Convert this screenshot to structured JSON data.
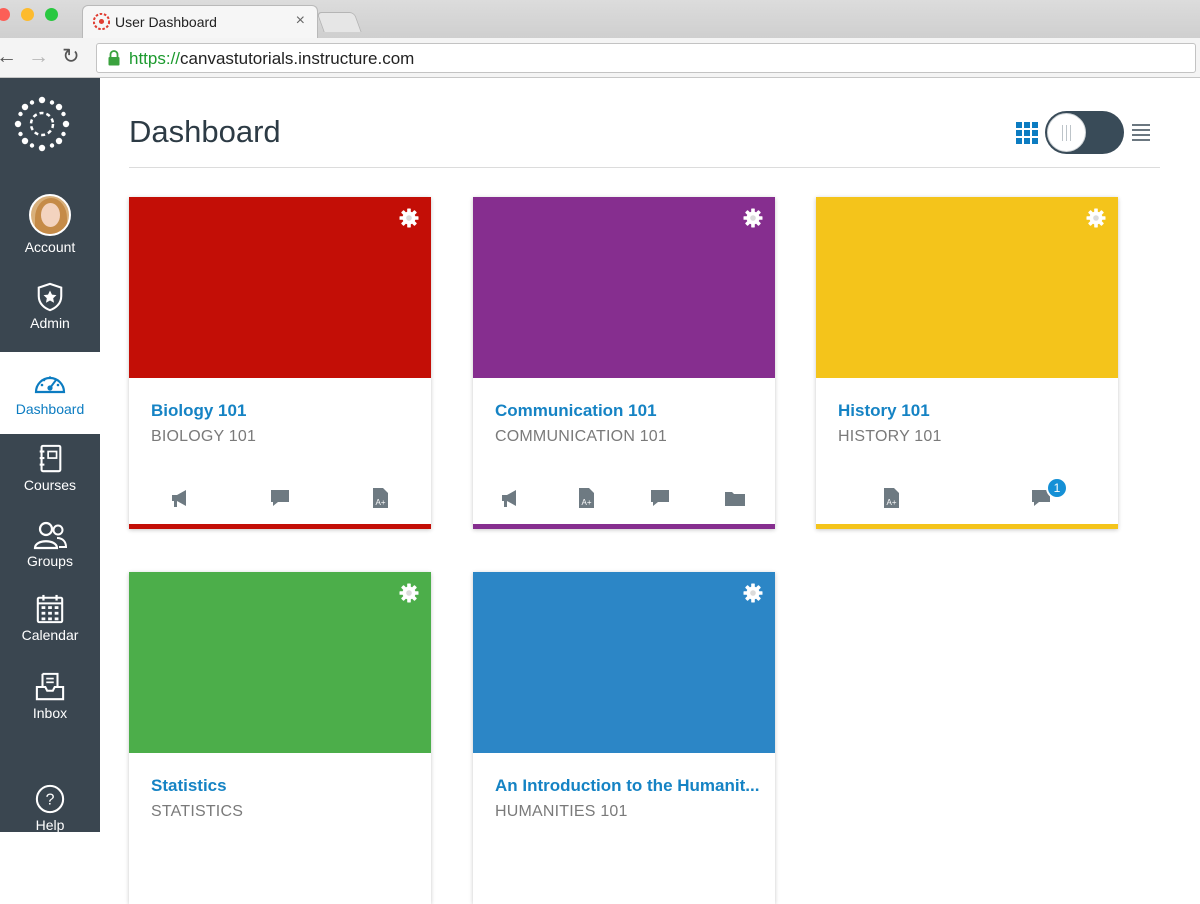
{
  "browser": {
    "tab_title": "User Dashboard",
    "tab_close": "×",
    "url_protocol": "https://",
    "url_host": "canvastutorials.instructure.com"
  },
  "sidebar": {
    "items": [
      {
        "label": "Account"
      },
      {
        "label": "Admin"
      },
      {
        "label": "Dashboard"
      },
      {
        "label": "Courses"
      },
      {
        "label": "Groups"
      },
      {
        "label": "Calendar"
      },
      {
        "label": "Inbox"
      },
      {
        "label": "Help"
      }
    ]
  },
  "dashboard": {
    "title": "Dashboard",
    "view": "card"
  },
  "cards": [
    {
      "title": "Biology 101",
      "subtitle": "BIOLOGY 101",
      "color": "#c30e06",
      "actions": [
        "announcements-icon",
        "discussions-icon",
        "assignments-icon"
      ]
    },
    {
      "title": "Communication 101",
      "subtitle": "COMMUNICATION 101",
      "color": "#862e8f",
      "actions": [
        "announcements-icon",
        "assignments-icon",
        "discussions-icon",
        "files-icon"
      ]
    },
    {
      "title": "History 101",
      "subtitle": "HISTORY 101",
      "color": "#f4c41b",
      "actions": [
        "assignments-icon",
        "discussions-icon"
      ],
      "badge": "1"
    },
    {
      "title": "Statistics",
      "subtitle": "STATISTICS",
      "color": "#4cae4a",
      "actions": []
    },
    {
      "title": "An Introduction to the Humanit...",
      "subtitle": "HUMANITIES 101",
      "color": "#2c86c6",
      "actions": []
    }
  ]
}
